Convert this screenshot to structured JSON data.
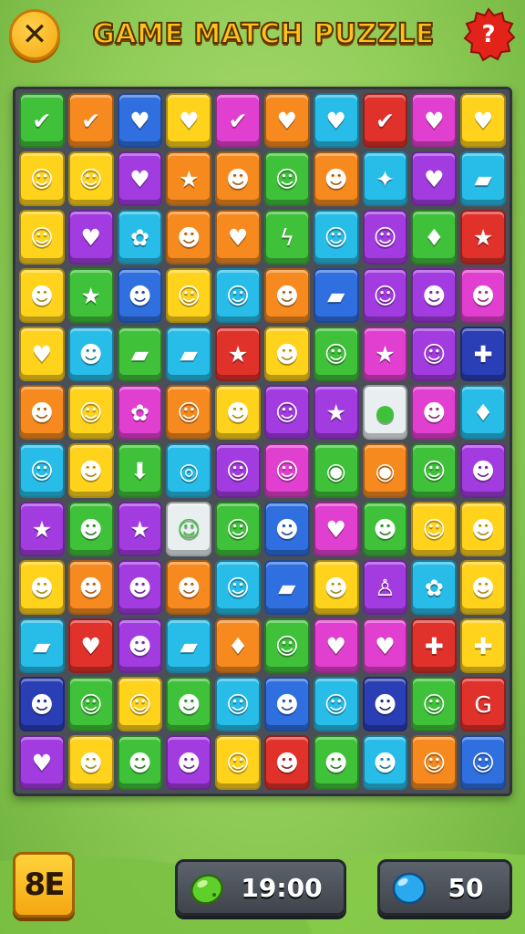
{
  "header": {
    "title": "GAME MATCH PUZZLE",
    "close_label": "✕",
    "help_label": "?"
  },
  "board": {
    "columns": 10,
    "rows": [
      [
        [
          "green",
          "✔"
        ],
        [
          "orange",
          "✔"
        ],
        [
          "blue",
          "♥"
        ],
        [
          "yellow",
          "♥"
        ],
        [
          "pink",
          "✔"
        ],
        [
          "orange",
          "♥"
        ],
        [
          "cyan",
          "♥"
        ],
        [
          "red",
          "✔"
        ],
        [
          "pink",
          "♥"
        ],
        [
          "yellow",
          "♥"
        ]
      ],
      [
        [
          "yellow",
          "☺"
        ],
        [
          "yellow",
          "☺"
        ],
        [
          "purple",
          "♥"
        ],
        [
          "orange",
          "★"
        ],
        [
          "orange",
          "☻"
        ],
        [
          "green",
          "☺"
        ],
        [
          "orange",
          "☻"
        ],
        [
          "cyan",
          "✦"
        ],
        [
          "purple",
          "♥"
        ],
        [
          "cyan",
          "▰"
        ]
      ],
      [
        [
          "yellow",
          "☺"
        ],
        [
          "purple",
          "♥"
        ],
        [
          "cyan",
          "✿"
        ],
        [
          "orange",
          "☻"
        ],
        [
          "orange",
          "♥"
        ],
        [
          "green",
          "ϟ"
        ],
        [
          "cyan",
          "☺"
        ],
        [
          "purple",
          "☺"
        ],
        [
          "green",
          "♦"
        ],
        [
          "red",
          "★"
        ]
      ],
      [
        [
          "yellow",
          "☻"
        ],
        [
          "green",
          "★"
        ],
        [
          "blue",
          "☻"
        ],
        [
          "yellow",
          "☺"
        ],
        [
          "cyan",
          "☺"
        ],
        [
          "orange",
          "☻"
        ],
        [
          "blue",
          "▰"
        ],
        [
          "purple",
          "☺"
        ],
        [
          "purple",
          "☻"
        ],
        [
          "pink",
          "☻"
        ]
      ],
      [
        [
          "yellow",
          "♥"
        ],
        [
          "cyan",
          "☻"
        ],
        [
          "green",
          "▰"
        ],
        [
          "cyan",
          "▰"
        ],
        [
          "red",
          "★"
        ],
        [
          "yellow",
          "☻"
        ],
        [
          "green",
          "☺"
        ],
        [
          "pink",
          "★"
        ],
        [
          "purple",
          "☺"
        ],
        [
          "navy",
          "✚"
        ]
      ],
      [
        [
          "orange",
          "☻"
        ],
        [
          "yellow",
          "☺"
        ],
        [
          "pink",
          "✿"
        ],
        [
          "orange",
          "☺"
        ],
        [
          "yellow",
          "☻"
        ],
        [
          "purple",
          "☺"
        ],
        [
          "purple",
          "★"
        ],
        [
          "white",
          "●"
        ],
        [
          "pink",
          "☻"
        ],
        [
          "cyan",
          "♦"
        ]
      ],
      [
        [
          "cyan",
          "☺"
        ],
        [
          "yellow",
          "☻"
        ],
        [
          "green",
          "⬇"
        ],
        [
          "cyan",
          "◎"
        ],
        [
          "purple",
          "☺"
        ],
        [
          "pink",
          "☺"
        ],
        [
          "green",
          "◉"
        ],
        [
          "orange",
          "◉"
        ],
        [
          "green",
          "☺"
        ],
        [
          "purple",
          "☻"
        ]
      ],
      [
        [
          "purple",
          "★"
        ],
        [
          "green",
          "☻"
        ],
        [
          "purple",
          "★"
        ],
        [
          "white",
          "☺"
        ],
        [
          "green",
          "☺"
        ],
        [
          "blue",
          "☻"
        ],
        [
          "pink",
          "♥"
        ],
        [
          "green",
          "☻"
        ],
        [
          "yellow",
          "☺"
        ],
        [
          "yellow",
          "☻"
        ]
      ],
      [
        [
          "yellow",
          "☻"
        ],
        [
          "orange",
          "☻"
        ],
        [
          "purple",
          "☻"
        ],
        [
          "orange",
          "☻"
        ],
        [
          "cyan",
          "☺"
        ],
        [
          "blue",
          "▰"
        ],
        [
          "yellow",
          "☻"
        ],
        [
          "purple",
          "♙"
        ],
        [
          "cyan",
          "✿"
        ],
        [
          "yellow",
          "☻"
        ]
      ],
      [
        [
          "cyan",
          "▰"
        ],
        [
          "red",
          "♥"
        ],
        [
          "purple",
          "☻"
        ],
        [
          "cyan",
          "▰"
        ],
        [
          "orange",
          "♦"
        ],
        [
          "green",
          "☺"
        ],
        [
          "pink",
          "♥"
        ],
        [
          "pink",
          "♥"
        ],
        [
          "red",
          "✚"
        ],
        [
          "yellow",
          "✚"
        ]
      ],
      [
        [
          "navy",
          "☻"
        ],
        [
          "green",
          "☺"
        ],
        [
          "yellow",
          "☺"
        ],
        [
          "green",
          "☻"
        ],
        [
          "cyan",
          "☺"
        ],
        [
          "blue",
          "☻"
        ],
        [
          "cyan",
          "☺"
        ],
        [
          "navy",
          "☻"
        ],
        [
          "green",
          "☺"
        ],
        [
          "red",
          "G"
        ]
      ],
      [
        [
          "purple",
          "♥"
        ],
        [
          "yellow",
          "☻"
        ],
        [
          "green",
          "☻"
        ],
        [
          "purple",
          "☻"
        ],
        [
          "yellow",
          "☺"
        ],
        [
          "red",
          "☻"
        ],
        [
          "green",
          "☻"
        ],
        [
          "cyan",
          "☻"
        ],
        [
          "orange",
          "☺"
        ],
        [
          "blue",
          "☺"
        ]
      ]
    ]
  },
  "footer": {
    "menu_label": "8E",
    "timer_value": "19:00",
    "gem_count": "50",
    "timer_icon": "green-leaf-icon",
    "gem_icon": "blue-gem-icon"
  },
  "colors": {
    "green": "#3fc23a",
    "orange": "#f68a1f",
    "blue": "#2f6fe0",
    "yellow": "#ffd21c",
    "purple": "#a23be0",
    "cyan": "#27bde8",
    "red": "#e0312a",
    "pink": "#e13fcf",
    "navy": "#2a3fb6",
    "white": "#e9eef0"
  }
}
